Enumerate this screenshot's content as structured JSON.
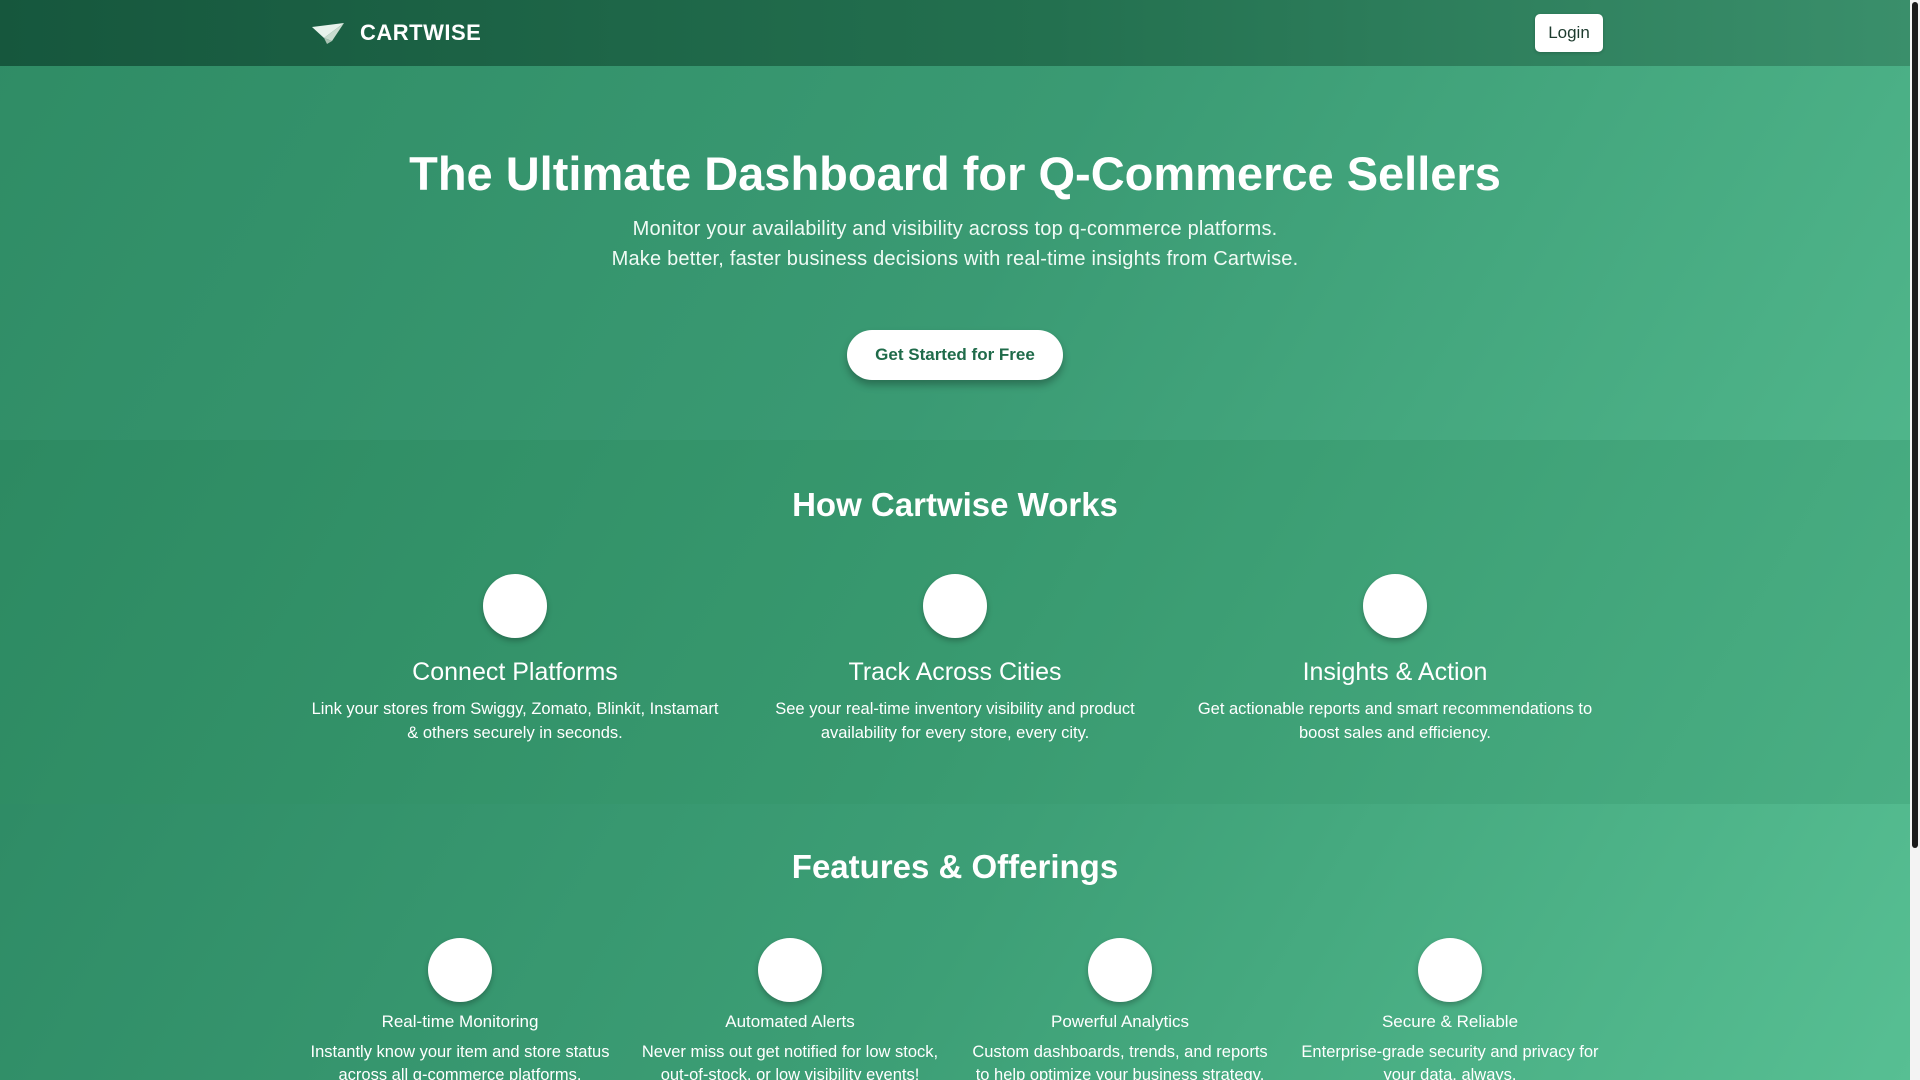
{
  "header": {
    "brand": "CARTWISE",
    "logo_icon": "paper-plane-icon",
    "login_label": "Login"
  },
  "hero": {
    "title": "The Ultimate Dashboard for Q-Commerce Sellers",
    "subtitle_line1": "Monitor your availability and visibility across top q-commerce platforms.",
    "subtitle_line2": "Make better, faster business decisions with real-time insights from Cartwise.",
    "cta_label": "Get Started for Free"
  },
  "how": {
    "title": "How Cartwise Works",
    "steps": [
      {
        "title": "Connect Platforms",
        "desc": "Link your stores from Swiggy, Zomato, Blinkit, Instamart & others securely in seconds."
      },
      {
        "title": "Track Across Cities",
        "desc": "See your real-time inventory visibility and product availability for every store, every city."
      },
      {
        "title": "Insights & Action",
        "desc": "Get actionable reports and smart recommendations to boost sales and efficiency."
      }
    ]
  },
  "features": {
    "title": "Features & Offerings",
    "items": [
      {
        "title": "Real-time Monitoring",
        "desc": "Instantly know your item and store status across all q-commerce platforms."
      },
      {
        "title": "Automated Alerts",
        "desc": "Never miss out get notified for low stock, out-of-stock, or low visibility events!"
      },
      {
        "title": "Powerful Analytics",
        "desc": "Custom dashboards, trends, and reports to help optimize your business strategy."
      },
      {
        "title": "Secure & Reliable",
        "desc": "Enterprise-grade security and privacy for your data, always."
      }
    ]
  },
  "colors": {
    "header": "#1f6a4a",
    "accent": "#3a9a73",
    "cta_text": "#1f6b4a"
  }
}
